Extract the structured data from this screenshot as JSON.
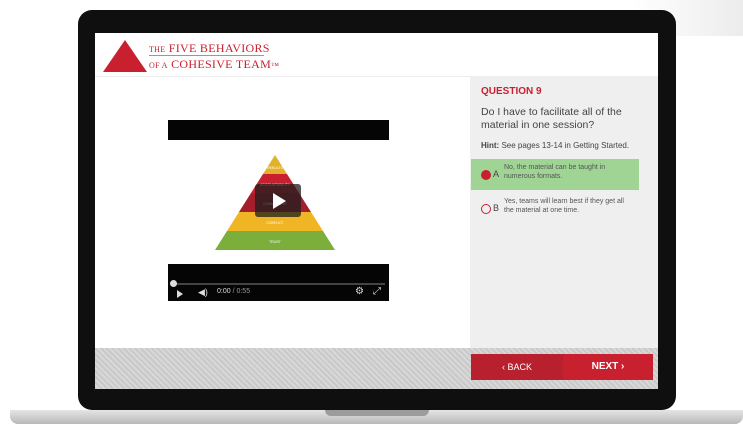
{
  "logo": {
    "line1_small": "THE",
    "line1": "FIVE BEHAVIORS",
    "line2_small": "OF A",
    "line2": "COHESIVE TEAM",
    "trademark": "™"
  },
  "question": {
    "number_label": "QUESTION 9",
    "text": "Do I have to facilitate all of the material in one session?",
    "hint_label": "Hint:",
    "hint_text": "See pages 13-14 in Getting Started."
  },
  "options": [
    {
      "letter": "A",
      "text": "No, the material can be taught in numerous formats.",
      "selected": true
    },
    {
      "letter": "B",
      "text": "Yes, teams will learn best if they get all the material at one time.",
      "selected": false
    }
  ],
  "video": {
    "current_time": "0:00",
    "duration": "/ 0:55",
    "progress": 0,
    "pyramid_levels": [
      "RESULTS",
      "ACCOUNTABILITY",
      "COMMITMENT",
      "CONFLICT",
      "TRUST"
    ]
  },
  "nav": {
    "back_label": "‹  BACK",
    "next_label": "NEXT  ›"
  },
  "colors": {
    "brand_red": "#c8202f",
    "correct_green": "#9fd494",
    "pyramid": [
      "#e2b12a",
      "#c8202f",
      "#a51e2c",
      "#f0b525",
      "#7cae3c"
    ]
  }
}
